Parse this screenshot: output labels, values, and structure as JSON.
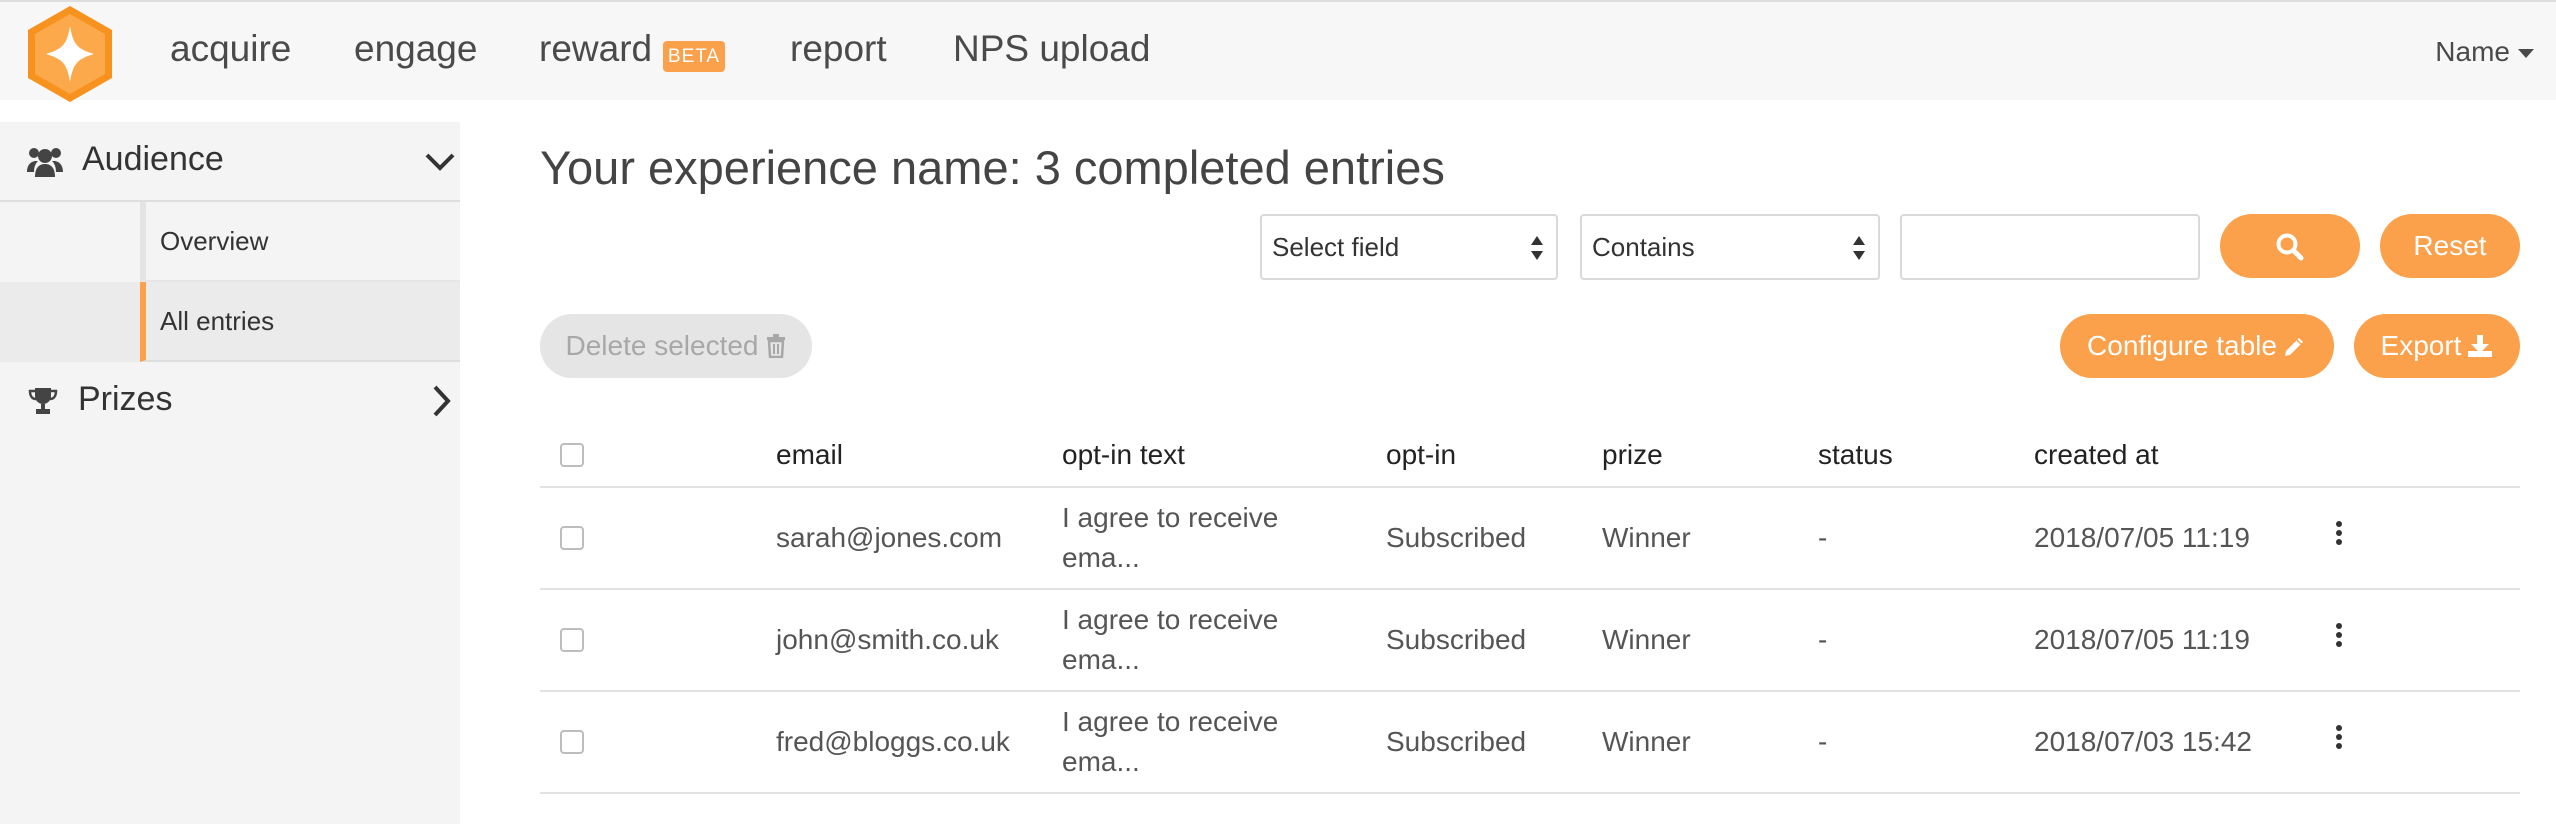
{
  "nav": {
    "items": [
      {
        "label": "acquire"
      },
      {
        "label": "engage"
      },
      {
        "label": "reward"
      },
      {
        "label": "report"
      },
      {
        "label": "NPS upload"
      }
    ],
    "beta_badge": "BETA",
    "user_label": "Name"
  },
  "sidebar": {
    "audience_label": "Audience",
    "overview_label": "Overview",
    "all_entries_label": "All entries",
    "prizes_label": "Prizes"
  },
  "page": {
    "title": "Your experience name: 3 completed entries"
  },
  "filters": {
    "field_select": "Select field",
    "operator_select": "Contains",
    "value": "",
    "reset_label": "Reset"
  },
  "actions": {
    "delete_label": "Delete selected",
    "configure_label": "Configure table",
    "export_label": "Export"
  },
  "table": {
    "headers": [
      "email",
      "opt-in text",
      "opt-in",
      "prize",
      "status",
      "created at"
    ],
    "rows": [
      {
        "email": "sarah@jones.com",
        "optin_text_1": "I agree to receive",
        "optin_text_2": "ema...",
        "optin": "Subscribed",
        "prize": "Winner",
        "status": "-",
        "created": "2018/07/05 11:19"
      },
      {
        "email": "john@smith.co.uk",
        "optin_text_1": "I agree to receive",
        "optin_text_2": "ema...",
        "optin": "Subscribed",
        "prize": "Winner",
        "status": "-",
        "created": "2018/07/05 11:19"
      },
      {
        "email": "fred@bloggs.co.uk",
        "optin_text_1": "I agree to receive",
        "optin_text_2": "ema...",
        "optin": "Subscribed",
        "prize": "Winner",
        "status": "-",
        "created": "2018/07/03 15:42"
      }
    ]
  },
  "colors": {
    "accent": "#fba04b",
    "sidebar_bg": "#f4f4f4"
  }
}
